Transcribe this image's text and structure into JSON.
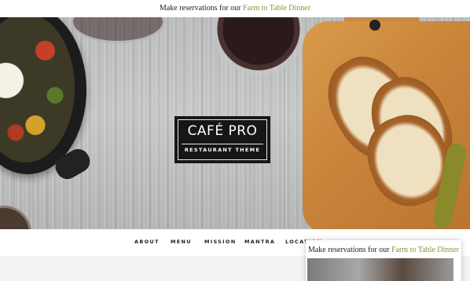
{
  "announcement": {
    "prefix": "Make reservations for our",
    "link_label": "Farm to Table Dinner"
  },
  "logo": {
    "title": "CAFÉ PRO",
    "subtitle": "RESTAURANT THEME"
  },
  "nav": {
    "items": [
      "ABOUT",
      "MENU",
      "MISSION",
      "MANTRA",
      "LOCATION"
    ]
  },
  "popup": {
    "prefix": "Make reservations for our",
    "link_label": "Farm to Table Dinner"
  },
  "colors": {
    "accent": "#7a9a3a",
    "logo_bg": "#161616"
  }
}
